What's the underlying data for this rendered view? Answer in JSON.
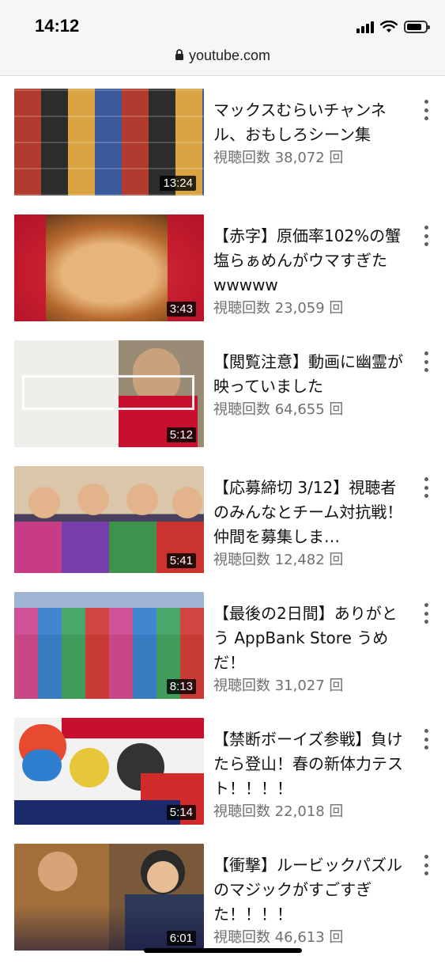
{
  "status": {
    "time": "14:12"
  },
  "browser": {
    "url": "youtube.com"
  },
  "videos": [
    {
      "title": "マックスむらいチャンネル、おもしろシーン集",
      "views": "視聴回数 38,072 回",
      "duration": "13:24",
      "caption": "",
      "colors": [
        "#b23a2e",
        "#3a5a9c"
      ]
    },
    {
      "title": "【赤字】原価率102%の蟹塩らぁめんがウマすぎたwwwww",
      "views": "視聴回数 23,059 回",
      "duration": "3:43",
      "caption": "",
      "colors": [
        "#c27a3c",
        "#6b3a1a"
      ]
    },
    {
      "title": "【閲覧注意】動画に幽霊が映っていました",
      "views": "視聴回数 64,655 回",
      "duration": "5:12",
      "caption": "",
      "colors": [
        "#e6e4e0",
        "#8c7b66"
      ]
    },
    {
      "title": "【応募締切 3/12】視聴者のみんなとチーム対抗戦！仲間を募集しま…",
      "views": "視聴回数 12,482 回",
      "duration": "5:41",
      "caption": "",
      "colors": [
        "#d7c4a6",
        "#3d3b5e"
      ]
    },
    {
      "title": "【最後の2日間】ありがとう AppBank Store うめだ！",
      "views": "視聴回数 31,027 回",
      "duration": "8:13",
      "caption": "",
      "colors": [
        "#8fa6c9",
        "#c7436a"
      ]
    },
    {
      "title": "【禁断ボーイズ参戦】負けたら登山！春の新体力テスト！！！！",
      "views": "視聴回数 22,018 回",
      "duration": "5:14",
      "caption": "",
      "colors": [
        "#f1f1f1",
        "#d22b2b"
      ]
    },
    {
      "title": "【衝撃】ルービックパズルのマジックがすごすぎた！！！！",
      "views": "視聴回数 46,613 回",
      "duration": "6:01",
      "caption": "",
      "colors": [
        "#a3703b",
        "#2f3a5a"
      ]
    }
  ]
}
